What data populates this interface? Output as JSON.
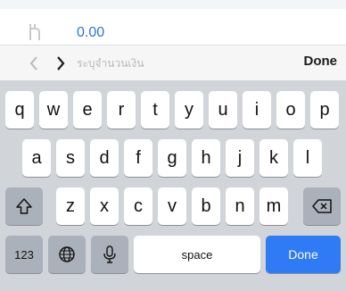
{
  "amount": {
    "value": "0.00",
    "currency_icon": "baht-icon"
  },
  "accessory_bar": {
    "prev_icon": "chevron-left-icon",
    "next_icon": "chevron-right-icon",
    "hint": "ระบุจำนวนเงิน",
    "done_label": "Done"
  },
  "keyboard": {
    "row1": [
      "q",
      "w",
      "e",
      "r",
      "t",
      "y",
      "u",
      "i",
      "o",
      "p"
    ],
    "row2": [
      "a",
      "s",
      "d",
      "f",
      "g",
      "h",
      "j",
      "k",
      "l"
    ],
    "row3": [
      "z",
      "x",
      "c",
      "v",
      "b",
      "n",
      "m"
    ],
    "shift_icon": "shift-icon",
    "delete_icon": "delete-icon",
    "numbers_label": "123",
    "globe_icon": "globe-icon",
    "mic_icon": "microphone-icon",
    "space_label": "space",
    "done_label": "Done"
  },
  "colors": {
    "accent": "#2f7bf6",
    "amount_text": "#2f73d8",
    "keyboard_bg": "#d1d4d9",
    "key_bg": "#ffffff",
    "special_key_bg": "#abb1ba"
  }
}
